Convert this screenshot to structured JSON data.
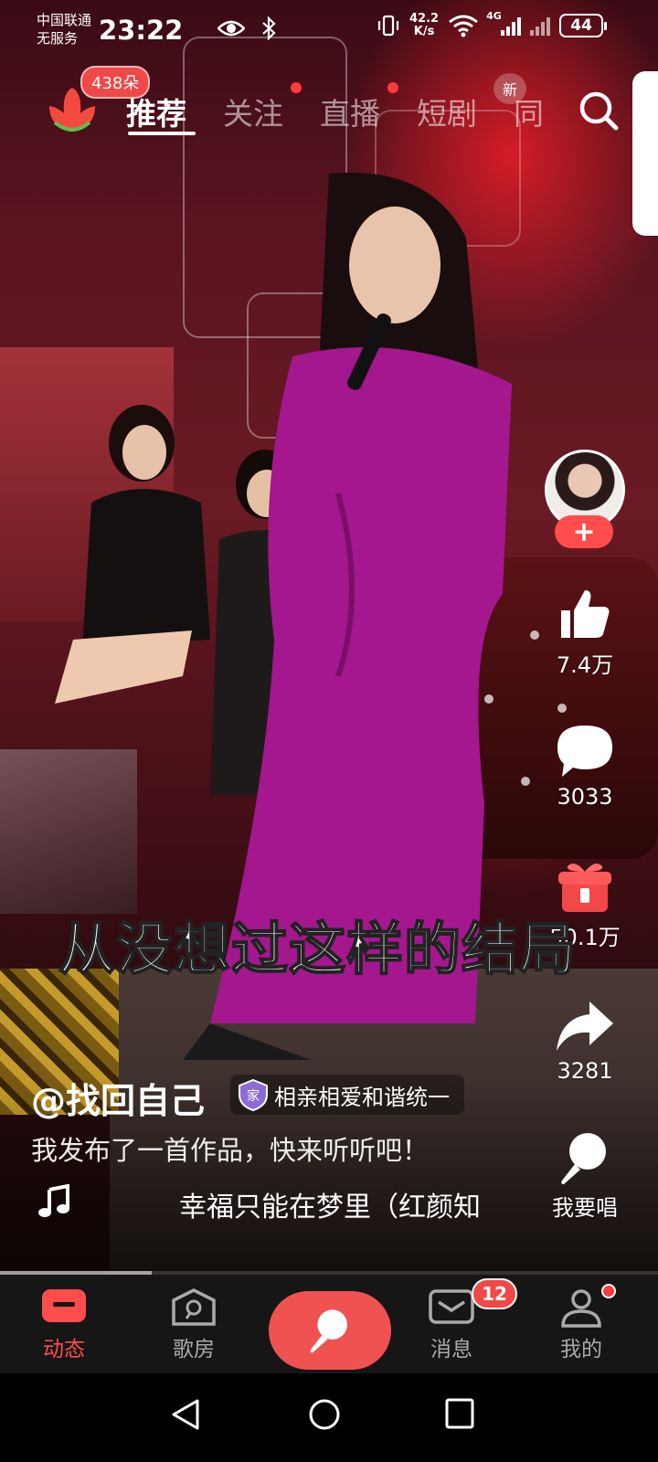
{
  "status_bar": {
    "carrier_line1": "中国联通",
    "carrier_line2": "无服务",
    "time": "23:22",
    "net_speed_value": "42.2",
    "net_speed_unit": "K/s",
    "network_type": "4G",
    "battery": "44"
  },
  "top_nav": {
    "flower_badge": "438朵",
    "tabs": [
      {
        "label": "推荐",
        "active": true
      },
      {
        "label": "关注",
        "dot": true
      },
      {
        "label": "直播",
        "dot": true
      },
      {
        "label": "短剧",
        "badge": "新"
      },
      {
        "label": "同"
      }
    ]
  },
  "video": {
    "subtitle": "从没想过这样的结局",
    "author": "@找回自己",
    "group_badge_icon": "家",
    "group_name": "相亲相爱和谐统一",
    "description": "我发布了一首作品，快来听听吧！",
    "song": "幸福只能在梦里（红颜知",
    "progress": 0.23
  },
  "actions": {
    "follow_label": "+",
    "likes": "7.4万",
    "comments": "3033",
    "gifts": "50.1万",
    "shares": "3281",
    "sing_label": "我要唱"
  },
  "bottom_nav": {
    "items": [
      {
        "label": "动态",
        "active": true
      },
      {
        "label": "歌房"
      },
      {
        "label": "消息",
        "badge": "12"
      },
      {
        "label": "我的",
        "dot": true
      }
    ]
  },
  "icons": {
    "search": "search-icon",
    "like": "thumbs-up-icon",
    "comment": "comment-icon",
    "gift": "gift-icon",
    "share": "share-icon",
    "mic": "microphone-icon",
    "music": "music-note-icon"
  },
  "colors": {
    "accent": "#ff4c4c",
    "nav_bg": "#161616"
  }
}
